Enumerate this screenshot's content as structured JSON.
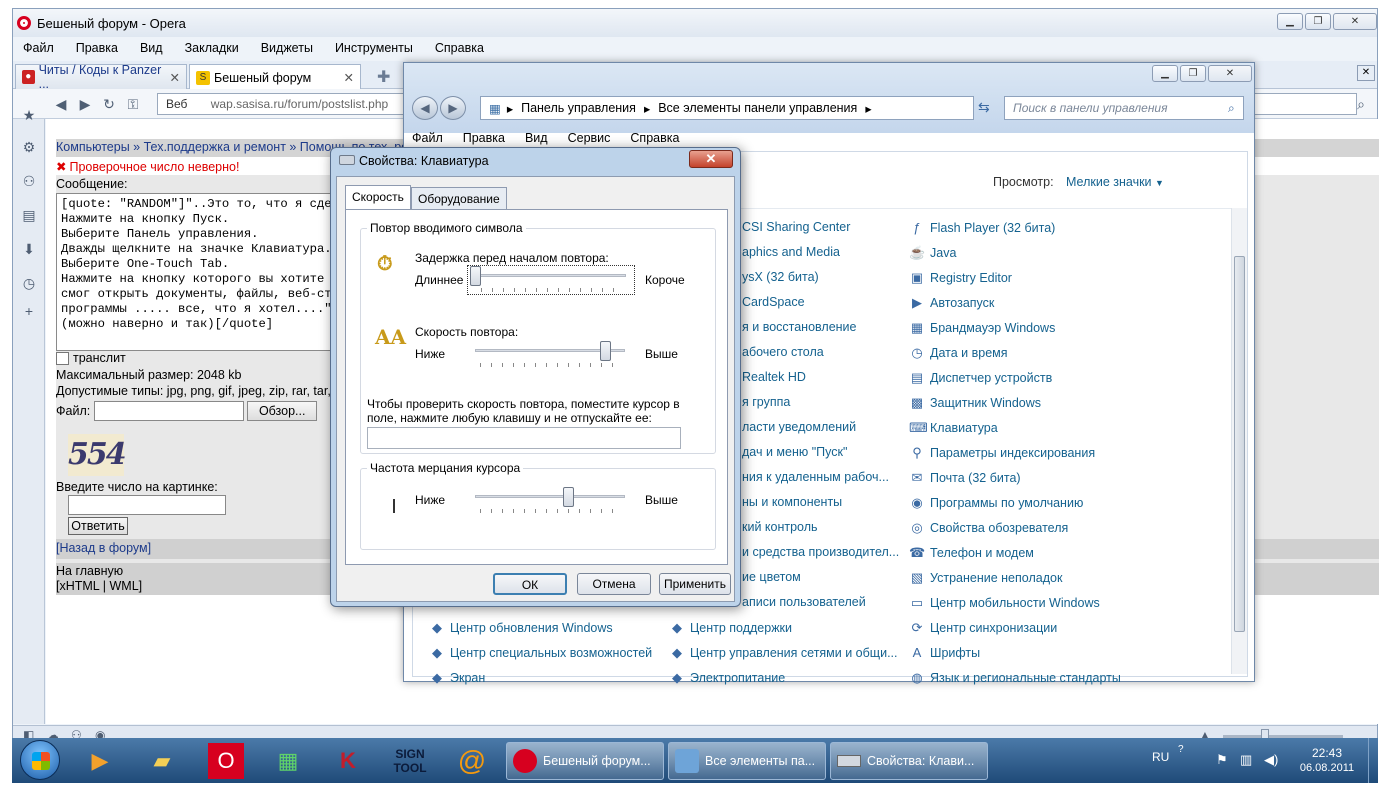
{
  "opera": {
    "title": "Бешеный форум - Opera",
    "menu": [
      "Файл",
      "Правка",
      "Вид",
      "Закладки",
      "Виджеты",
      "Инструменты",
      "Справка"
    ],
    "tabs": [
      {
        "label": "Читы / Коды к Panzer ..."
      },
      {
        "label": "Бешеный форум"
      }
    ],
    "address_label": "Веб",
    "address": "wap.sasisa.ru/forum/postslist.php"
  },
  "forum": {
    "breadcrumb": "Компьютеры » Тех.поддержка и ремонт » Помощь по тех. ре",
    "error": "Проверочное число неверно!",
    "message_label": "Сообщение:",
    "message_lines": [
      "[quote: \"RANDOM\"]\"..Это то, что я сдела",
      "Нажмите на кнопку Пуск.",
      "Выберите Панель управления.",
      "Дважды щелкните на значке Клавиатура.",
      "Выберите One-Touch Tab.",
      "Нажмите на кнопку которого вы хотите из",
      "смог открыть документы, файлы, веб-стра",
      "программы ..... все, что я хотел....\"",
      "(можно наверно и так)[/quote]"
    ],
    "translit": "транслит",
    "max_size": "Максимальный размер: 2048 kb",
    "types": "Допустимые типы: jpg, png, gif, jpeg, zip, rar, tar, а",
    "file_label": "Файл:",
    "browse": "Обзор...",
    "captcha": "554",
    "captcha_prompt": "Введите число на картинке:",
    "submit": "Ответить",
    "back": "[Назад в форум]",
    "home": "На главную",
    "formats": "[xHTML | WML]"
  },
  "control_panel": {
    "crumbs": [
      "Панель управления",
      "Все элементы панели управления"
    ],
    "search_placeholder": "Поиск в панели управления",
    "menu": [
      "Файл",
      "Правка",
      "Вид",
      "Сервис",
      "Справка"
    ],
    "view_label": "Просмотр:",
    "view_value": "Мелкие значки",
    "col1_partial": [
      "CSI Sharing Center",
      "aphics and Media",
      "ysX (32 бита)",
      "CardSpace",
      "я и восстановление",
      "абочего стола",
      "Realtek HD",
      "я группа",
      "ласти уведомлений",
      "дач и меню \"Пуск\"",
      "ния к удаленным рабоч...",
      "ны и компоненты",
      "кий контроль",
      "и средства производител...",
      "ие цветом",
      "аписи пользователей"
    ],
    "col2": [
      {
        "label": "Flash Player (32 бита)",
        "icon": "flash-icon"
      },
      {
        "label": "Java",
        "icon": "java-icon"
      },
      {
        "label": "Registry Editor",
        "icon": "registry-icon"
      },
      {
        "label": "Автозапуск",
        "icon": "autoplay-icon"
      },
      {
        "label": "Брандмауэр Windows",
        "icon": "firewall-icon"
      },
      {
        "label": "Дата и время",
        "icon": "clock-icon"
      },
      {
        "label": "Диспетчер устройств",
        "icon": "devices-icon"
      },
      {
        "label": "Защитник Windows",
        "icon": "defender-icon"
      },
      {
        "label": "Клавиатура",
        "icon": "keyboard-icon"
      },
      {
        "label": "Параметры индексирования",
        "icon": "index-icon"
      },
      {
        "label": "Почта (32 бита)",
        "icon": "mail-icon"
      },
      {
        "label": "Программы по умолчанию",
        "icon": "defaults-icon"
      },
      {
        "label": "Свойства обозревателя",
        "icon": "internet-icon"
      },
      {
        "label": "Телефон и модем",
        "icon": "phone-icon"
      },
      {
        "label": "Устранение неполадок",
        "icon": "troubleshoot-icon"
      },
      {
        "label": "Центр мобильности Windows",
        "icon": "mobility-icon"
      },
      {
        "label": "Центр синхронизации",
        "icon": "sync-icon"
      },
      {
        "label": "Шрифты",
        "icon": "fonts-icon"
      },
      {
        "label": "Язык и региональные стандарты",
        "icon": "region-icon"
      }
    ],
    "bottom_rows": [
      [
        "Центр обновления Windows",
        "Центр поддержки"
      ],
      [
        "Центр специальных возможностей",
        "Центр управления сетями и общи..."
      ],
      [
        "Экран",
        "Электропитание"
      ]
    ]
  },
  "dialog": {
    "title": "Свойства: Клавиатура",
    "tabs": [
      "Скорость",
      "Оборудование"
    ],
    "group1": "Повтор вводимого символа",
    "delay_label": "Задержка перед началом повтора:",
    "delay_left": "Длиннее",
    "delay_right": "Короче",
    "delay_value": 0,
    "rate_label": "Скорость повтора:",
    "rate_left": "Ниже",
    "rate_right": "Выше",
    "rate_value": 0.9,
    "test_text": "Чтобы проверить скорость повтора, поместите курсор в поле, нажмите любую клавишу и не отпускайте ее:",
    "group2": "Частота мерцания курсора",
    "blink_left": "Ниже",
    "blink_right": "Выше",
    "blink_value": 0.65,
    "ok": "ОК",
    "cancel": "Отмена",
    "apply": "Применить"
  },
  "taskbar": {
    "tasks": [
      "Бешеный форум...",
      "Все элементы па...",
      "Свойства: Клави..."
    ],
    "lang": "RU",
    "time": "22:43",
    "date": "06.08.2011",
    "pinned": [
      "media-player-icon",
      "explorer-icon",
      "opera-icon",
      "task-manager-icon",
      "kaspersky-icon",
      "signtool-icon",
      "mail-agent-icon"
    ]
  }
}
